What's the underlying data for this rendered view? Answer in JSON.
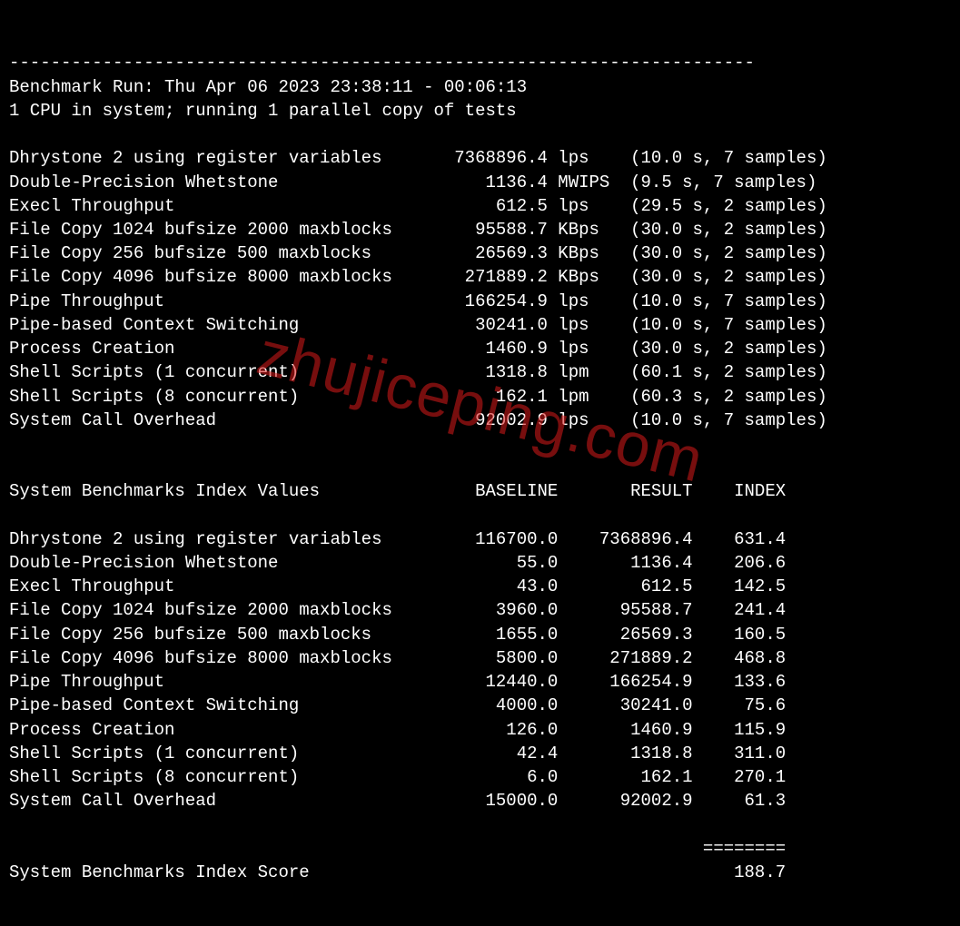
{
  "watermark": "zhujiceping.com",
  "divider_top": "------------------------------------------------------------------------",
  "header": {
    "run_line": "Benchmark Run: Thu Apr 06 2023 23:38:11 - 00:06:13",
    "cpu_line": "1 CPU in system; running 1 parallel copy of tests"
  },
  "tests": [
    {
      "name": "Dhrystone 2 using register variables",
      "value": "7368896.4",
      "unit": "lps",
      "timing": "(10.0 s, 7 samples)"
    },
    {
      "name": "Double-Precision Whetstone",
      "value": "1136.4",
      "unit": "MWIPS",
      "timing": "(9.5 s, 7 samples)"
    },
    {
      "name": "Execl Throughput",
      "value": "612.5",
      "unit": "lps",
      "timing": "(29.5 s, 2 samples)"
    },
    {
      "name": "File Copy 1024 bufsize 2000 maxblocks",
      "value": "95588.7",
      "unit": "KBps",
      "timing": "(30.0 s, 2 samples)"
    },
    {
      "name": "File Copy 256 bufsize 500 maxblocks",
      "value": "26569.3",
      "unit": "KBps",
      "timing": "(30.0 s, 2 samples)"
    },
    {
      "name": "File Copy 4096 bufsize 8000 maxblocks",
      "value": "271889.2",
      "unit": "KBps",
      "timing": "(30.0 s, 2 samples)"
    },
    {
      "name": "Pipe Throughput",
      "value": "166254.9",
      "unit": "lps",
      "timing": "(10.0 s, 7 samples)"
    },
    {
      "name": "Pipe-based Context Switching",
      "value": "30241.0",
      "unit": "lps",
      "timing": "(10.0 s, 7 samples)"
    },
    {
      "name": "Process Creation",
      "value": "1460.9",
      "unit": "lps",
      "timing": "(30.0 s, 2 samples)"
    },
    {
      "name": "Shell Scripts (1 concurrent)",
      "value": "1318.8",
      "unit": "lpm",
      "timing": "(60.1 s, 2 samples)"
    },
    {
      "name": "Shell Scripts (8 concurrent)",
      "value": "162.1",
      "unit": "lpm",
      "timing": "(60.3 s, 2 samples)"
    },
    {
      "name": "System Call Overhead",
      "value": "92002.9",
      "unit": "lps",
      "timing": "(10.0 s, 7 samples)"
    }
  ],
  "index_header": {
    "label": "System Benchmarks Index Values",
    "col_baseline": "BASELINE",
    "col_result": "RESULT",
    "col_index": "INDEX"
  },
  "index_rows": [
    {
      "name": "Dhrystone 2 using register variables",
      "baseline": "116700.0",
      "result": "7368896.4",
      "index": "631.4"
    },
    {
      "name": "Double-Precision Whetstone",
      "baseline": "55.0",
      "result": "1136.4",
      "index": "206.6"
    },
    {
      "name": "Execl Throughput",
      "baseline": "43.0",
      "result": "612.5",
      "index": "142.5"
    },
    {
      "name": "File Copy 1024 bufsize 2000 maxblocks",
      "baseline": "3960.0",
      "result": "95588.7",
      "index": "241.4"
    },
    {
      "name": "File Copy 256 bufsize 500 maxblocks",
      "baseline": "1655.0",
      "result": "26569.3",
      "index": "160.5"
    },
    {
      "name": "File Copy 4096 bufsize 8000 maxblocks",
      "baseline": "5800.0",
      "result": "271889.2",
      "index": "468.8"
    },
    {
      "name": "Pipe Throughput",
      "baseline": "12440.0",
      "result": "166254.9",
      "index": "133.6"
    },
    {
      "name": "Pipe-based Context Switching",
      "baseline": "4000.0",
      "result": "30241.0",
      "index": "75.6"
    },
    {
      "name": "Process Creation",
      "baseline": "126.0",
      "result": "1460.9",
      "index": "115.9"
    },
    {
      "name": "Shell Scripts (1 concurrent)",
      "baseline": "42.4",
      "result": "1318.8",
      "index": "311.0"
    },
    {
      "name": "Shell Scripts (8 concurrent)",
      "baseline": "6.0",
      "result": "162.1",
      "index": "270.1"
    },
    {
      "name": "System Call Overhead",
      "baseline": "15000.0",
      "result": "92002.9",
      "index": "61.3"
    }
  ],
  "score_divider": "                                                                   ========",
  "score_label": "System Benchmarks Index Score",
  "score_value": "188.7"
}
